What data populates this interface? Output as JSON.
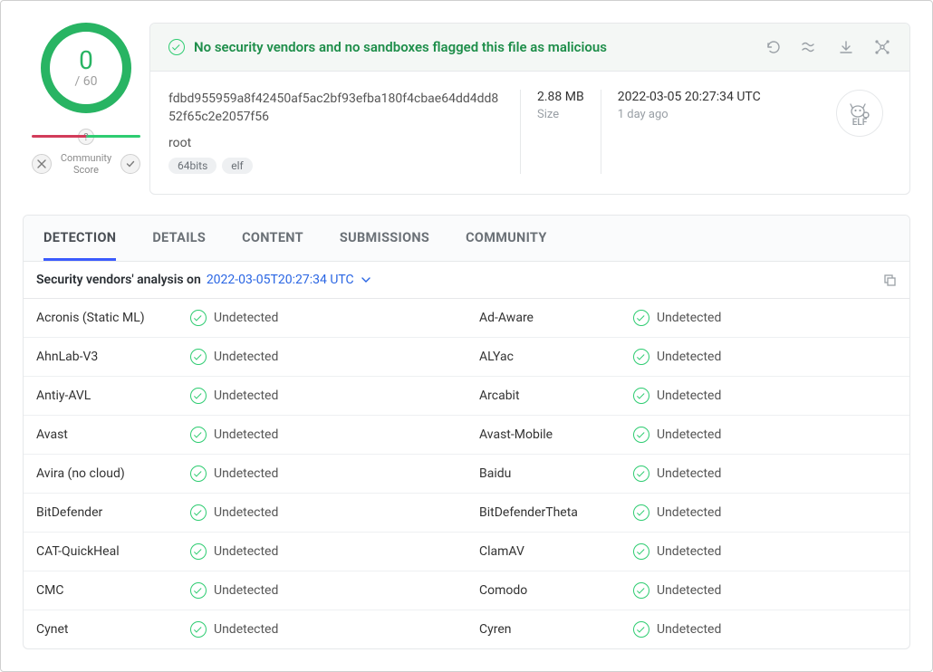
{
  "score": {
    "detections": "0",
    "total": "/ 60"
  },
  "community": {
    "question": "?",
    "label_line1": "Community",
    "label_line2": "Score"
  },
  "banner": {
    "message": "No security vendors and no sandboxes flagged this file as malicious"
  },
  "file": {
    "hash": "fdbd955959a8f42450af5ac2bf93efba180f4cbae64dd4dd852f65c2e2057f56",
    "name": "root",
    "tags": [
      "64bits",
      "elf"
    ],
    "size_value": "2.88 MB",
    "size_label": "Size",
    "time_value": "2022-03-05 20:27:34 UTC",
    "time_ago": "1 day ago",
    "type_label": "ELF"
  },
  "tabs": [
    "DETECTION",
    "DETAILS",
    "CONTENT",
    "SUBMISSIONS",
    "COMMUNITY"
  ],
  "analysis": {
    "label": "Security vendors' analysis on",
    "timestamp": "2022-03-05T20:27:34 UTC"
  },
  "vendors": [
    {
      "name": "Acronis (Static ML)",
      "verdict": "Undetected"
    },
    {
      "name": "Ad-Aware",
      "verdict": "Undetected"
    },
    {
      "name": "AhnLab-V3",
      "verdict": "Undetected"
    },
    {
      "name": "ALYac",
      "verdict": "Undetected"
    },
    {
      "name": "Antiy-AVL",
      "verdict": "Undetected"
    },
    {
      "name": "Arcabit",
      "verdict": "Undetected"
    },
    {
      "name": "Avast",
      "verdict": "Undetected"
    },
    {
      "name": "Avast-Mobile",
      "verdict": "Undetected"
    },
    {
      "name": "Avira (no cloud)",
      "verdict": "Undetected"
    },
    {
      "name": "Baidu",
      "verdict": "Undetected"
    },
    {
      "name": "BitDefender",
      "verdict": "Undetected"
    },
    {
      "name": "BitDefenderTheta",
      "verdict": "Undetected"
    },
    {
      "name": "CAT-QuickHeal",
      "verdict": "Undetected"
    },
    {
      "name": "ClamAV",
      "verdict": "Undetected"
    },
    {
      "name": "CMC",
      "verdict": "Undetected"
    },
    {
      "name": "Comodo",
      "verdict": "Undetected"
    },
    {
      "name": "Cynet",
      "verdict": "Undetected"
    },
    {
      "name": "Cyren",
      "verdict": "Undetected"
    }
  ]
}
